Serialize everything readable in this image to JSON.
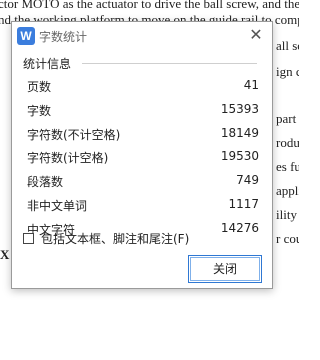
{
  "document": {
    "lines": [
      "ctor MOTO as the actuator to drive the ball screw, and the sc",
      "nd the working platform to move on the guide rail to comple",
      "",
      "all sc",
      "ign c",
      "part c",
      "roductic",
      "es full",
      "applic",
      "ility a",
      "r cou",
      "X"
    ]
  },
  "dialog": {
    "title": "字数统计",
    "app_icon_letter": "W",
    "close_glyph": "✕",
    "section_title": "统计信息",
    "stats": [
      {
        "label": "页数",
        "value": "41"
      },
      {
        "label": "字数",
        "value": "15393"
      },
      {
        "label": "字符数(不计空格)",
        "value": "18149"
      },
      {
        "label": "字符数(计空格)",
        "value": "19530"
      },
      {
        "label": "段落数",
        "value": "749"
      },
      {
        "label": "非中文单词",
        "value": "1117"
      },
      {
        "label": "中文字符",
        "value": "14276"
      }
    ],
    "checkbox_label": "包括文本框、脚注和尾注(F)",
    "close_button_label": "关闭"
  },
  "colors": {
    "accent": "#2f78d3",
    "icon_bg": "#3b7ddd"
  }
}
